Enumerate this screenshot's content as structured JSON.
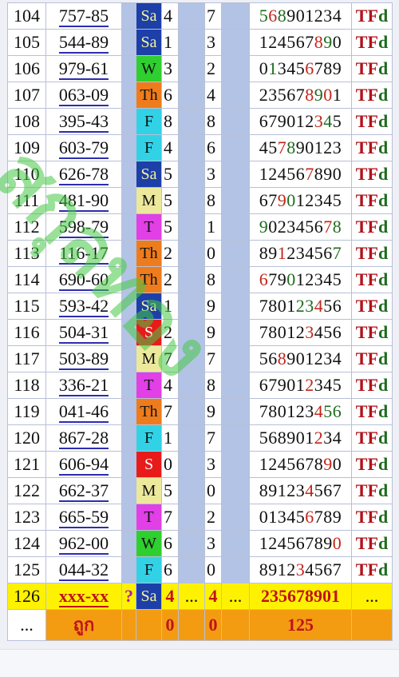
{
  "colors": {
    "Sa": "#1d3fa8",
    "W": "#2fcf2f",
    "Th": "#ee7c1c",
    "F": "#31d2e6",
    "M": "#ece99c",
    "T": "#e040e6",
    "S": "#e81b1b"
  },
  "rows": [
    {
      "no": "104",
      "num": "757-85",
      "day": "Sa",
      "a": "4",
      "b": "7",
      "seq": [
        [
          "5",
          "g"
        ],
        [
          "6",
          "r"
        ],
        [
          "8",
          "g"
        ],
        [
          "901234",
          "n"
        ]
      ],
      "tag": "TFd"
    },
    {
      "no": "105",
      "num": "544-89",
      "day": "Sa",
      "a": "1",
      "b": "3",
      "seq": [
        [
          "124567",
          "n"
        ],
        [
          "8",
          "r"
        ],
        [
          "9",
          "g"
        ],
        [
          "0",
          "n"
        ]
      ],
      "tag": "TFd"
    },
    {
      "no": "106",
      "num": "979-61",
      "day": "W",
      "a": "3",
      "b": "2",
      "seq": [
        [
          "0",
          "n"
        ],
        [
          "1",
          "g"
        ],
        [
          "345",
          "n"
        ],
        [
          "6",
          "r"
        ],
        [
          "789",
          "n"
        ]
      ],
      "tag": "TFd"
    },
    {
      "no": "107",
      "num": "063-09",
      "day": "Th",
      "a": "6",
      "b": "4",
      "seq": [
        [
          "23567",
          "n"
        ],
        [
          "8",
          "r"
        ],
        [
          "9",
          "g"
        ],
        [
          "0",
          "r"
        ],
        [
          "1",
          "n"
        ]
      ],
      "tag": "TFd"
    },
    {
      "no": "108",
      "num": "395-43",
      "day": "F",
      "a": "8",
      "b": "8",
      "seq": [
        [
          "679012",
          "n"
        ],
        [
          "3",
          "r"
        ],
        [
          "4",
          "g"
        ],
        [
          "5",
          "n"
        ]
      ],
      "tag": "TFd"
    },
    {
      "no": "109",
      "num": "603-79",
      "day": "F",
      "a": "4",
      "b": "6",
      "seq": [
        [
          "45",
          "n"
        ],
        [
          "7",
          "r"
        ],
        [
          "8",
          "g"
        ],
        [
          "90123",
          "n"
        ]
      ],
      "tag": "TFd"
    },
    {
      "no": "110",
      "num": "626-78",
      "day": "Sa",
      "a": "5",
      "b": "3",
      "seq": [
        [
          "12456",
          "n"
        ],
        [
          "7",
          "r"
        ],
        [
          "890",
          "n"
        ]
      ],
      "tag": "TFd"
    },
    {
      "no": "111",
      "num": "481-90",
      "day": "M",
      "a": "5",
      "b": "8",
      "seq": [
        [
          "67",
          "n"
        ],
        [
          "9",
          "r"
        ],
        [
          "0",
          "g"
        ],
        [
          "12345",
          "n"
        ]
      ],
      "tag": "TFd"
    },
    {
      "no": "112",
      "num": "598-79",
      "day": "T",
      "a": "5",
      "b": "1",
      "seq": [
        [
          "9",
          "g"
        ],
        [
          "023456",
          "n"
        ],
        [
          "7",
          "r"
        ],
        [
          "8",
          "g"
        ]
      ],
      "tag": "TFd"
    },
    {
      "no": "113",
      "num": "116-17",
      "day": "Th",
      "a": "2",
      "b": "0",
      "seq": [
        [
          "89",
          "n"
        ],
        [
          "1",
          "r"
        ],
        [
          "23456",
          "n"
        ],
        [
          "7",
          "g"
        ]
      ],
      "tag": "TFd"
    },
    {
      "no": "114",
      "num": "690-60",
      "day": "Th",
      "a": "2",
      "b": "8",
      "seq": [
        [
          "6",
          "r"
        ],
        [
          "79",
          "n"
        ],
        [
          "0",
          "g"
        ],
        [
          "12345",
          "n"
        ]
      ],
      "tag": "TFd"
    },
    {
      "no": "115",
      "num": "593-42",
      "day": "Sa",
      "a": "1",
      "b": "9",
      "seq": [
        [
          "7801",
          "n"
        ],
        [
          "2",
          "g"
        ],
        [
          "3",
          "g"
        ],
        [
          "4",
          "r"
        ],
        [
          "56",
          "n"
        ]
      ],
      "tag": "TFd"
    },
    {
      "no": "116",
      "num": "504-31",
      "day": "S",
      "a": "2",
      "b": "9",
      "seq": [
        [
          "78012",
          "n"
        ],
        [
          "3",
          "r"
        ],
        [
          "456",
          "n"
        ]
      ],
      "tag": "TFd"
    },
    {
      "no": "117",
      "num": "503-89",
      "day": "M",
      "a": "7",
      "b": "7",
      "seq": [
        [
          "56",
          "n"
        ],
        [
          "8",
          "r"
        ],
        [
          "901234",
          "n"
        ]
      ],
      "tag": "TFd"
    },
    {
      "no": "118",
      "num": "336-21",
      "day": "T",
      "a": "4",
      "b": "8",
      "seq": [
        [
          "67901",
          "n"
        ],
        [
          "2",
          "r"
        ],
        [
          "345",
          "n"
        ]
      ],
      "tag": "TFd"
    },
    {
      "no": "119",
      "num": "041-46",
      "day": "Th",
      "a": "7",
      "b": "9",
      "seq": [
        [
          "780123",
          "n"
        ],
        [
          "4",
          "r"
        ],
        [
          "56",
          "g"
        ]
      ],
      "tag": "TFd"
    },
    {
      "no": "120",
      "num": "867-28",
      "day": "F",
      "a": "1",
      "b": "7",
      "seq": [
        [
          "568901",
          "n"
        ],
        [
          "2",
          "r"
        ],
        [
          "34",
          "n"
        ]
      ],
      "tag": "TFd"
    },
    {
      "no": "121",
      "num": "606-94",
      "day": "S",
      "a": "0",
      "b": "3",
      "seq": [
        [
          "1245678",
          "n"
        ],
        [
          "9",
          "r"
        ],
        [
          "0",
          "n"
        ]
      ],
      "tag": "TFd"
    },
    {
      "no": "122",
      "num": "662-37",
      "day": "M",
      "a": "5",
      "b": "0",
      "seq": [
        [
          "89123",
          "n"
        ],
        [
          "4",
          "r"
        ],
        [
          "567",
          "n"
        ]
      ],
      "tag": "TFd"
    },
    {
      "no": "123",
      "num": "665-59",
      "day": "T",
      "a": "7",
      "b": "2",
      "seq": [
        [
          "01345",
          "n"
        ],
        [
          "6",
          "r"
        ],
        [
          "789",
          "n"
        ]
      ],
      "tag": "TFd"
    },
    {
      "no": "124",
      "num": "962-00",
      "day": "W",
      "a": "6",
      "b": "3",
      "seq": [
        [
          "12456789",
          "n"
        ],
        [
          "0",
          "r"
        ]
      ],
      "tag": "TFd"
    },
    {
      "no": "125",
      "num": "044-32",
      "day": "F",
      "a": "6",
      "b": "0",
      "seq": [
        [
          "8912",
          "n"
        ],
        [
          "3",
          "r"
        ],
        [
          "4567",
          "n"
        ]
      ],
      "tag": "TFd"
    }
  ],
  "pending": {
    "no": "126",
    "num": "xxx-xx",
    "mark": "?",
    "day": "Sa",
    "a": "4",
    "dots1": "...",
    "b": "4",
    "dots2": "...",
    "seq": "235678901",
    "dots3": "..."
  },
  "summary": {
    "dots": "...",
    "label": "ถูก",
    "a": "0",
    "b": "0",
    "total": "125"
  },
  "watermark": "สกุลทอง"
}
